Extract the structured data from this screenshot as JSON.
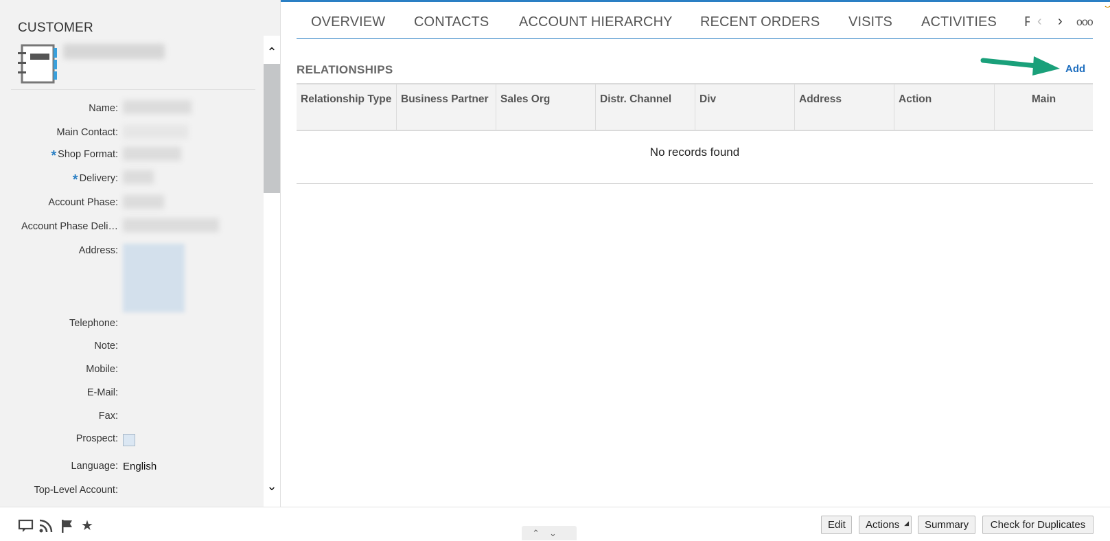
{
  "customer_panel": {
    "title": "CUSTOMER",
    "fields": {
      "name": "Name:",
      "main_contact": "Main Contact:",
      "shop_format": "Shop Format:",
      "delivery": "Delivery:",
      "account_phase": "Account Phase:",
      "account_phase_delivery": "Account Phase Deli…",
      "address": "Address:",
      "telephone": "Telephone:",
      "note": "Note:",
      "mobile": "Mobile:",
      "email": "E-Mail:",
      "fax": "Fax:",
      "prospect": "Prospect:",
      "language": "Language:",
      "top_level_account": "Top-Level Account:"
    },
    "required_marker": "*",
    "language_value": "English",
    "prospect_checked": false,
    "scroll_up_icon": "chevron-up-icon",
    "scroll_down_icon": "chevron-down-icon"
  },
  "tabs": [
    {
      "label": "OVERVIEW"
    },
    {
      "label": "CONTACTS"
    },
    {
      "label": "ACCOUNT HIERARCHY"
    },
    {
      "label": "RECENT ORDERS"
    },
    {
      "label": "VISITS"
    },
    {
      "label": "ACTIVITIES"
    },
    {
      "label": "F"
    }
  ],
  "tab_more": "ooo",
  "relationships": {
    "title": "RELATIONSHIPS",
    "add_label": "Add",
    "columns": [
      "Relationship Type",
      "Business Partner",
      "Sales Org",
      "Distr. Channel",
      "Div",
      "Address",
      "Action",
      "Main"
    ],
    "empty_message": "No records found"
  },
  "footer": {
    "icons": [
      "chat-icon",
      "rss-feed-icon",
      "flag-icon",
      "star-icon"
    ],
    "buttons": {
      "edit": "Edit",
      "actions": "Actions",
      "summary": "Summary",
      "check_duplicates": "Check for Duplicates"
    }
  },
  "colors": {
    "accent": "#2a7fc4",
    "link": "#1f6fbf",
    "arrow": "#1aa07a",
    "panel_bg": "#f2f2f2"
  }
}
